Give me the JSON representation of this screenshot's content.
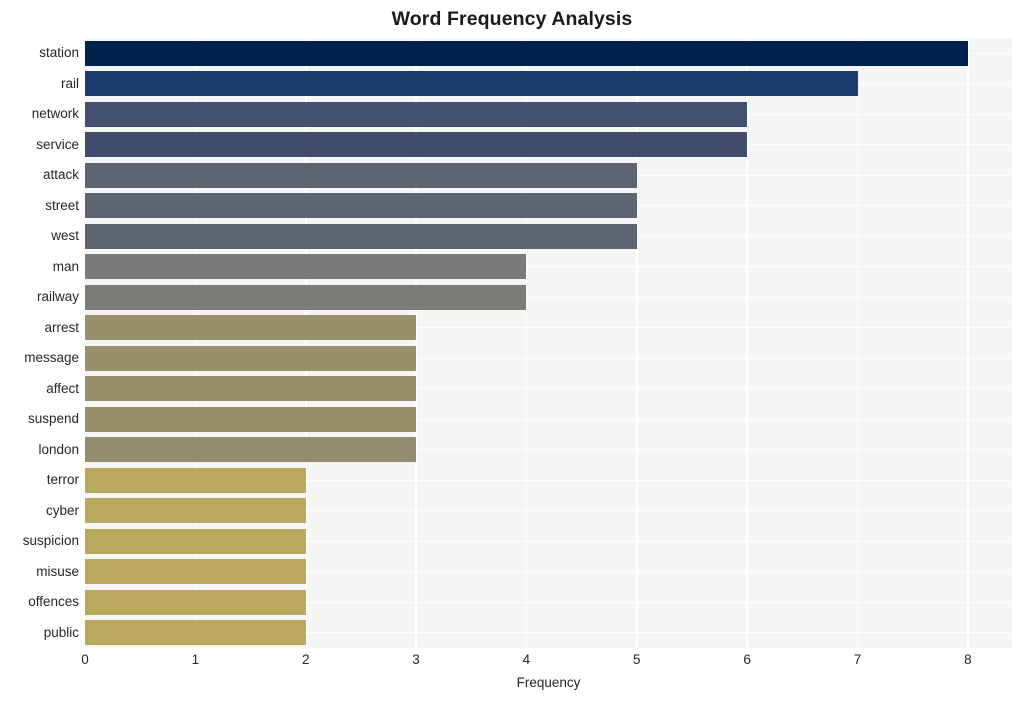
{
  "chart_data": {
    "type": "bar",
    "orientation": "horizontal",
    "title": "Word Frequency Analysis",
    "xlabel": "Frequency",
    "ylabel": "",
    "xlim": [
      0,
      8.4
    ],
    "xticks": [
      0,
      1,
      2,
      3,
      4,
      5,
      6,
      7,
      8
    ],
    "xtick_labels": [
      "0",
      "1",
      "2",
      "3",
      "4",
      "5",
      "6",
      "7",
      "8"
    ],
    "grid": true,
    "grid_axis": "both",
    "legend": null,
    "categories": [
      "station",
      "rail",
      "network",
      "service",
      "attack",
      "street",
      "west",
      "man",
      "railway",
      "arrest",
      "message",
      "affect",
      "suspend",
      "london",
      "terror",
      "cyber",
      "suspicion",
      "misuse",
      "offences",
      "public"
    ],
    "values": [
      8,
      7,
      6,
      6,
      5,
      5,
      5,
      4,
      4,
      3,
      3,
      3,
      3,
      3,
      2,
      2,
      2,
      2,
      2,
      2
    ],
    "colors": [
      "#00224e",
      "#1b3c6e",
      "#44506f",
      "#414d6b",
      "#5c6472",
      "#5e6572",
      "#5e6572",
      "#7a7a78",
      "#7b7b78",
      "#99906e",
      "#99906e",
      "#99906e",
      "#99906e",
      "#948c6f",
      "#baa85f",
      "#baa85f",
      "#baa85f",
      "#baa85f",
      "#baa85f",
      "#baa85f"
    ],
    "colormap": "cividis",
    "plot_background": "#f5f5f6",
    "grid_color": "#ffffff",
    "figure_background": "#ffffff"
  }
}
